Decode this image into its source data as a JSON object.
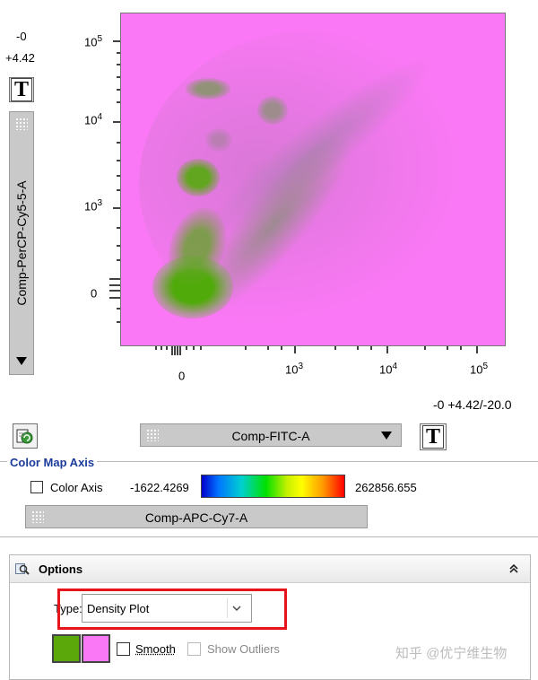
{
  "y_axis": {
    "range_min": "-0",
    "range_max": "+4.42",
    "parameter": "Comp-PerCP-Cy5-5-A",
    "tick_labels": [
      {
        "base": "10",
        "exp": "5"
      },
      {
        "base": "10",
        "exp": "4"
      },
      {
        "base": "10",
        "exp": "3"
      },
      {
        "base": "0",
        "exp": ""
      }
    ]
  },
  "x_axis": {
    "parameter": "Comp-FITC-A",
    "range_readout": "-0 +4.42/-20.0",
    "tick_labels": [
      {
        "base": "0",
        "exp": ""
      },
      {
        "base": "10",
        "exp": "3"
      },
      {
        "base": "10",
        "exp": "4"
      },
      {
        "base": "10",
        "exp": "5"
      }
    ]
  },
  "text_button_glyph": "T",
  "color_map": {
    "section_title": "Color Map Axis",
    "checkbox_label": "Color Axis",
    "min_value": "-1622.4269",
    "max_value": "262856.655",
    "parameter": "Comp-APC-Cy7-A"
  },
  "options": {
    "title": "Options",
    "type_label": "Type:",
    "type_value": "Density Plot",
    "smooth_label": "Smooth",
    "show_outliers_label": "Show Outliers",
    "low_color": "#5aa80a",
    "high_color": "#fa78f5"
  },
  "watermark": "知乎 @优宁维生物"
}
